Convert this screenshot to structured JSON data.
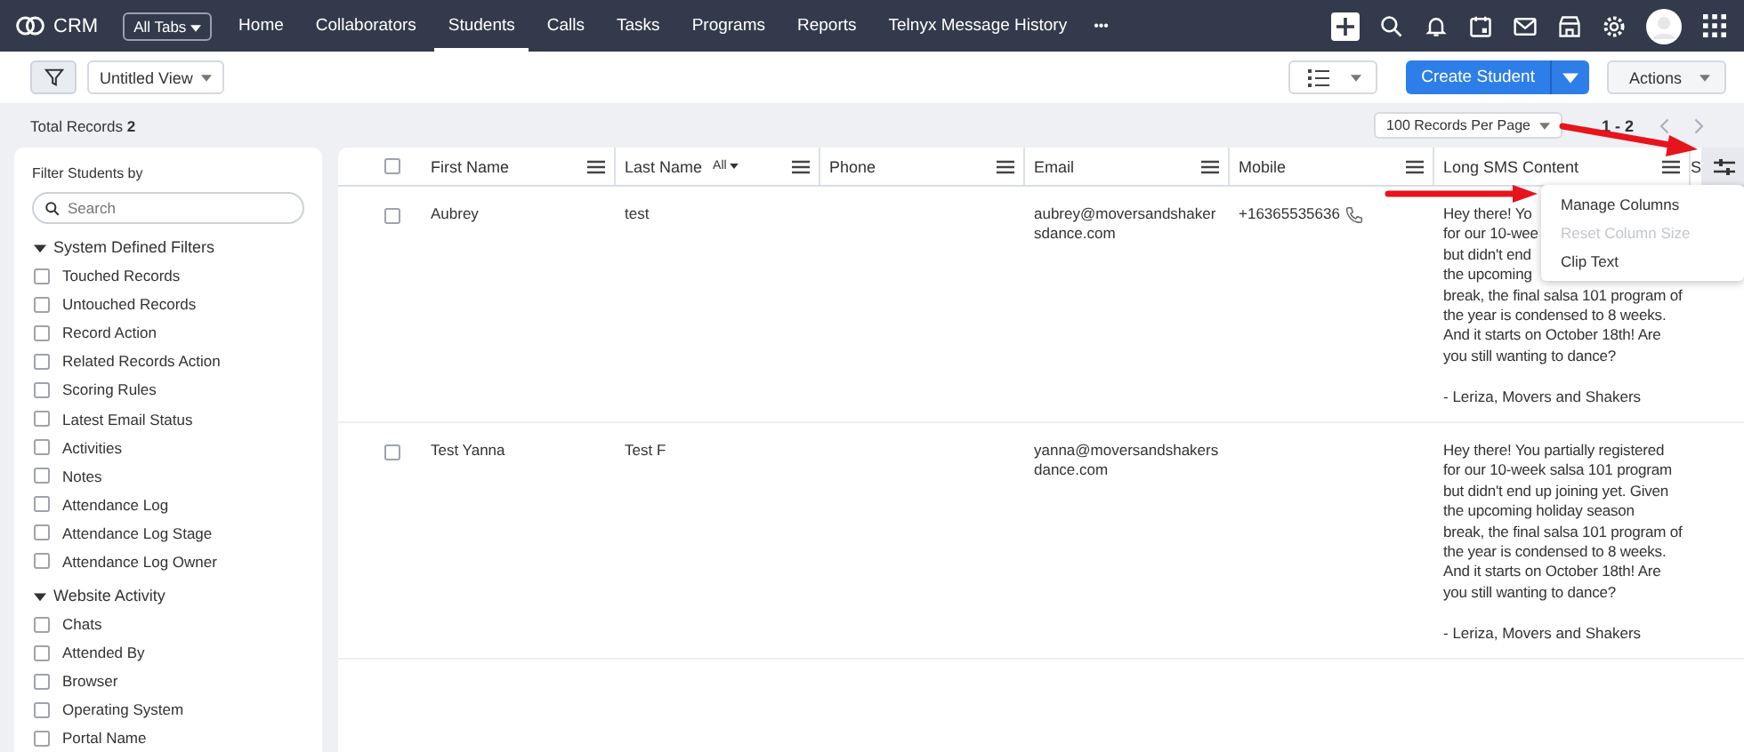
{
  "nav": {
    "app_name": "CRM",
    "all_tabs": "All Tabs",
    "more": "•••",
    "tabs": [
      {
        "label": "Home",
        "selected": false
      },
      {
        "label": "Collaborators",
        "selected": false
      },
      {
        "label": "Students",
        "selected": true
      },
      {
        "label": "Calls",
        "selected": false
      },
      {
        "label": "Tasks",
        "selected": false
      },
      {
        "label": "Programs",
        "selected": false
      },
      {
        "label": "Reports",
        "selected": false
      },
      {
        "label": "Telnyx Message History",
        "selected": false
      }
    ]
  },
  "toolbar": {
    "view": "Untitled View",
    "create_button": "Create Student",
    "actions": "Actions"
  },
  "summary": {
    "label": "Total Records",
    "count": "2"
  },
  "pagination": {
    "per_page": "100 Records Per Page",
    "range": "1 - 2"
  },
  "sidebar": {
    "title": "Filter Students by",
    "search": {
      "placeholder": "Search"
    },
    "groups": [
      {
        "title": "System Defined Filters",
        "expanded": true,
        "items": [
          {
            "label": "Touched Records",
            "checked": false
          },
          {
            "label": "Untouched Records",
            "checked": false
          },
          {
            "label": "Record Action",
            "checked": false
          },
          {
            "label": "Related Records Action",
            "checked": false
          },
          {
            "label": "Scoring Rules",
            "checked": false
          },
          {
            "label": "Latest Email Status",
            "checked": false
          },
          {
            "label": "Activities",
            "checked": false
          },
          {
            "label": "Notes",
            "checked": false
          },
          {
            "label": "Attendance Log",
            "checked": false
          },
          {
            "label": "Attendance Log Stage",
            "checked": false
          },
          {
            "label": "Attendance Log Owner",
            "checked": false
          }
        ]
      },
      {
        "title": "Website Activity",
        "expanded": true,
        "items": [
          {
            "label": "Chats",
            "checked": false
          },
          {
            "label": "Attended By",
            "checked": false
          },
          {
            "label": "Browser",
            "checked": false
          },
          {
            "label": "Operating System",
            "checked": false
          },
          {
            "label": "Portal Name",
            "checked": false
          }
        ]
      }
    ]
  },
  "table": {
    "select_all": {
      "checked": false
    },
    "columns": [
      {
        "label": "First Name"
      },
      {
        "label": "Last Name",
        "filter": "All"
      },
      {
        "label": "Phone"
      },
      {
        "label": "Email"
      },
      {
        "label": "Mobile"
      },
      {
        "label": "Long SMS Content"
      },
      {
        "label": "S"
      }
    ],
    "rows": [
      {
        "checked": false,
        "first_name": "Aubrey",
        "last_name": "test",
        "email": "aubrey@moversandshakersdance.com",
        "mobile": "+16365535636",
        "sms": [
          "Hey there! Yo\nfor our 10-wee\nbut didn't end\nthe upcoming",
          "break, the final salsa 101 program of\nthe year is condensed to 8 weeks.\nAnd it starts on October 18th! Are\nyou still wanting to dance?"
        ],
        "signature": "- Leriza, Movers and Shakers"
      },
      {
        "checked": false,
        "first_name": "Test Yanna",
        "last_name": "Test F",
        "email": "yanna@moversandshakersdance.com",
        "sms": [
          "Hey there! You partially registered\nfor our 10-week salsa 101 program\nbut didn't end up joining yet. Given\nthe upcoming holiday season\nbreak, the final salsa 101 program of\nthe year is condensed to 8 weeks.\nAnd it starts on October 18th! Are\nyou still wanting to dance?"
        ],
        "signature": "- Leriza, Movers and Shakers"
      }
    ]
  },
  "column_menu": {
    "items": [
      {
        "label": "Manage Columns",
        "disabled": false
      },
      {
        "label": "Reset Column Size",
        "disabled": true
      },
      {
        "label": "Clip Text",
        "disabled": false
      }
    ]
  }
}
